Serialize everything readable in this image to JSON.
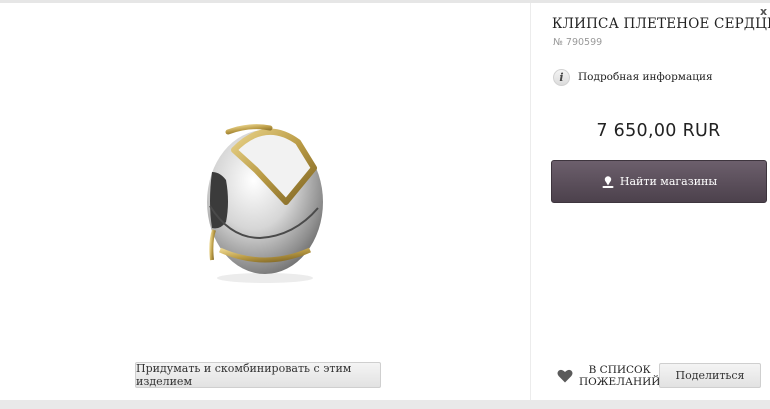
{
  "product": {
    "title": "КЛИПСА ПЛЕТЕНОЕ СЕРДЦЕ",
    "number": "№ 790599",
    "info_label": "Подробная информация",
    "info_icon_glyph": "i",
    "price": "7 650,00 RUR"
  },
  "actions": {
    "find_stores_label": "Найти магазины",
    "combine_label": "Придумать и скомбинировать с этим изделием",
    "wishlist_line1": "В СПИСОК",
    "wishlist_line2": "ПОЖЕЛАНИЙ",
    "share_label": "Поделиться",
    "close_glyph": "x"
  },
  "colors": {
    "find_button_bg": "#5a4e5a",
    "heart": "#5a5a5a"
  }
}
